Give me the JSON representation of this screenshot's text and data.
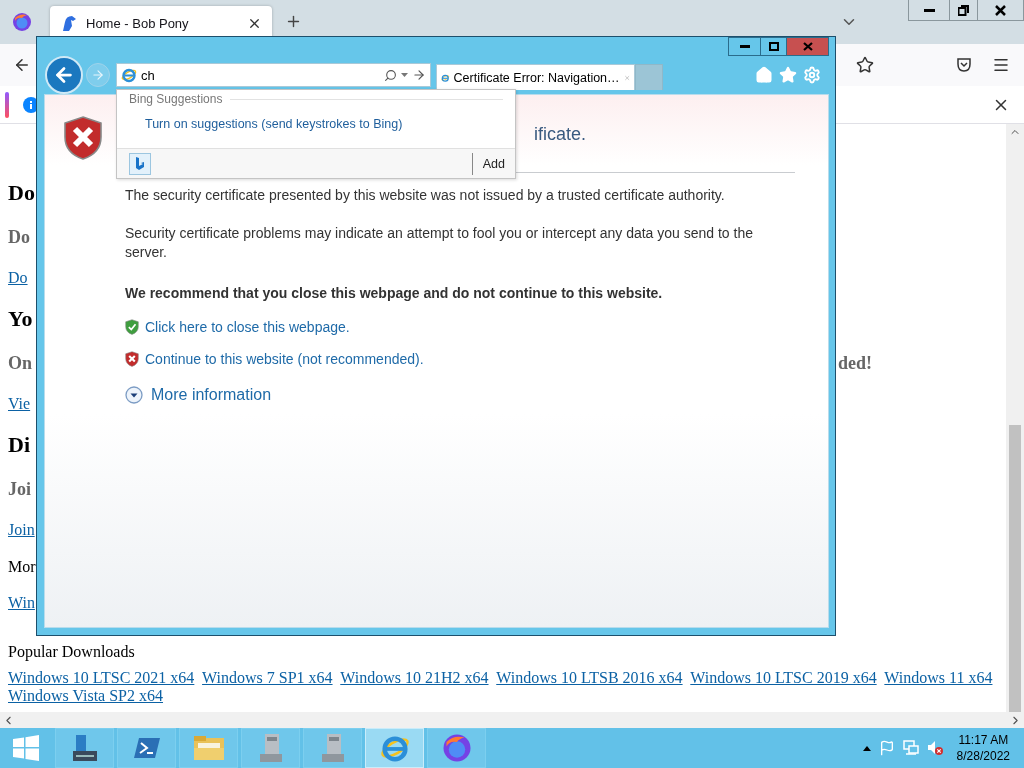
{
  "firefox": {
    "tabs": [
      {
        "title": "Home - Bob Pony",
        "selected": true
      }
    ],
    "page": {
      "lines": [
        {
          "kind": "heading",
          "text": "Do"
        },
        {
          "kind": "subheading",
          "text": "Do"
        },
        {
          "kind": "link",
          "text": "Do"
        },
        {
          "kind": "heading",
          "text": "Yo"
        },
        {
          "kind": "subheading",
          "text": "On",
          "tail": "ded!"
        },
        {
          "kind": "link",
          "text": "Vie"
        },
        {
          "kind": "heading",
          "text": "Di"
        },
        {
          "kind": "subheading",
          "text": "Joi"
        },
        {
          "kind": "link",
          "text": "Join"
        },
        {
          "kind": "text",
          "text": "Mor"
        },
        {
          "kind": "link",
          "text": "Win"
        }
      ],
      "popular_title": "Popular Downloads",
      "popular_links": [
        "Windows 10 LTSC 2021 x64",
        "Windows 7 SP1 x64",
        "Windows 10 21H2 x64",
        "Windows 10 LTSB 2016 x64",
        "Windows 10 LTSC 2019 x64",
        "Windows 11 x64",
        "Windows Vista SP2 x64"
      ]
    }
  },
  "ie": {
    "address": {
      "value": "ch"
    },
    "tabs": [
      {
        "title": "Certificate Error: Navigation…",
        "selected": true
      }
    ],
    "suggestions": {
      "header": "Bing Suggestions",
      "link": "Turn on suggestions (send keystrokes to Bing)",
      "add": "Add"
    },
    "page": {
      "title": "ificate.",
      "paragraphs": [
        "The security certificate presented by this website was not issued by a trusted certificate authority.",
        "Security certificate problems may indicate an attempt to fool you or intercept any data you send to the server."
      ],
      "recommendation": "We recommend that you close this webpage and do not continue to this website.",
      "actions": [
        {
          "kind": "safe",
          "text": "Click here to close this webpage."
        },
        {
          "kind": "unsafe",
          "text": "Continue to this website (not recommended)."
        }
      ],
      "more": "More information"
    }
  },
  "taskbar": {
    "apps": [
      {
        "kind": "server-manager",
        "selected": false
      },
      {
        "kind": "powershell",
        "selected": false
      },
      {
        "kind": "explorer",
        "selected": false
      },
      {
        "kind": "server-tool",
        "selected": false
      },
      {
        "kind": "server-tool",
        "selected": false
      },
      {
        "kind": "ie",
        "selected": true
      },
      {
        "kind": "firefox",
        "selected": false
      }
    ],
    "time": "11:17 AM",
    "date": "8/28/2022"
  }
}
